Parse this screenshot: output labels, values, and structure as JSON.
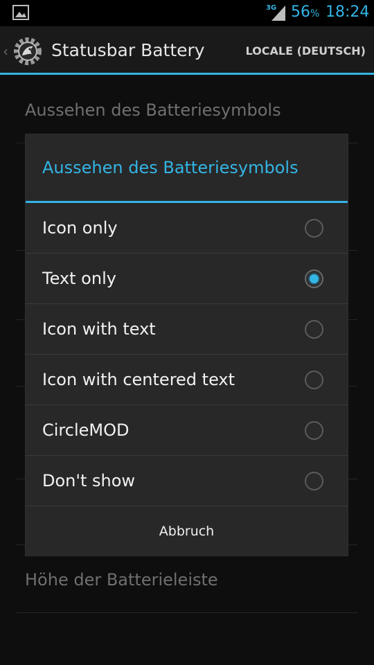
{
  "status_bar": {
    "network": "3G",
    "battery_value": "56",
    "battery_unit": "%",
    "time": "18:24",
    "accent": "#33b5e5"
  },
  "action_bar": {
    "title": "Statusbar Battery",
    "action": "LOCALE (DEUTSCH)"
  },
  "background_list": {
    "items": [
      {
        "title": "Aussehen des Batteriesymbols"
      },
      {
        "title": "Höhe der Batterieleiste"
      }
    ]
  },
  "dialog": {
    "title": "Aussehen des Batteriesymbols",
    "options": [
      {
        "label": "Icon only",
        "checked": false
      },
      {
        "label": "Text only",
        "checked": true
      },
      {
        "label": "Icon with text",
        "checked": false
      },
      {
        "label": "Icon with centered text",
        "checked": false
      },
      {
        "label": "CircleMOD",
        "checked": false
      },
      {
        "label": "Don't show",
        "checked": false
      }
    ],
    "cancel_label": "Abbruch"
  }
}
